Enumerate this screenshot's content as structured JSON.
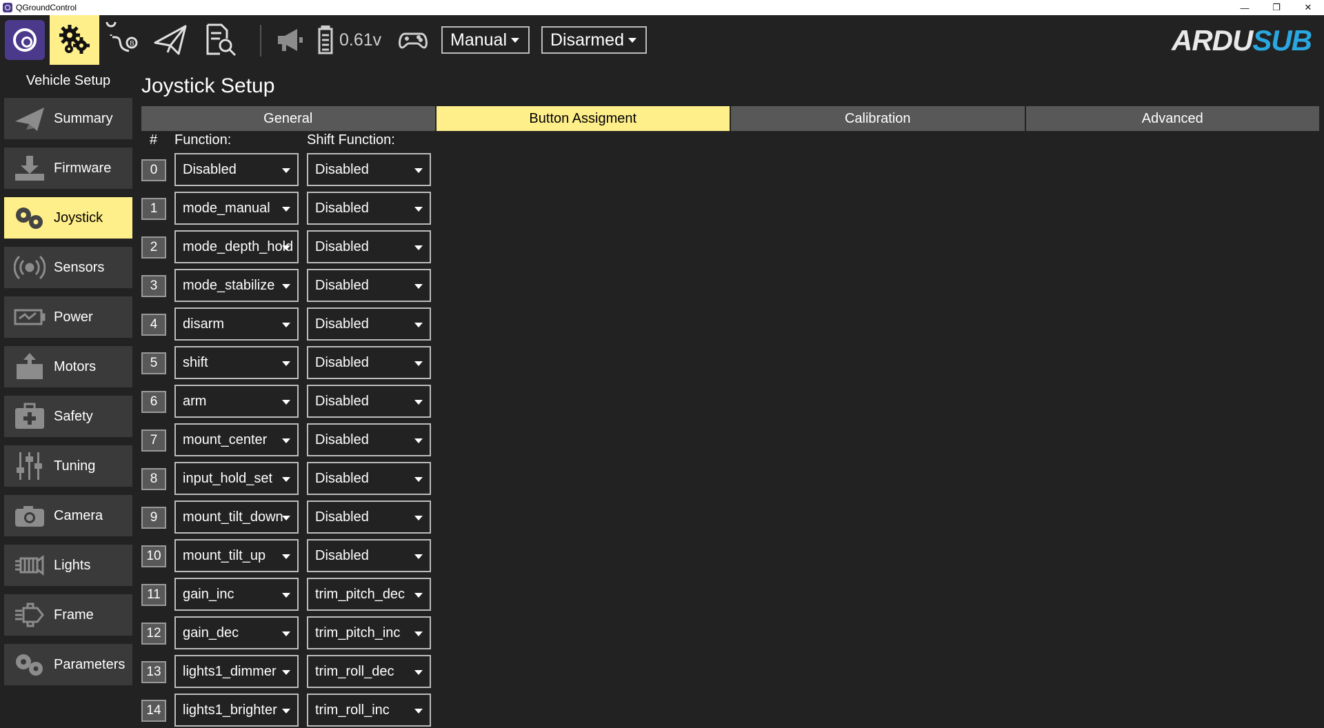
{
  "window": {
    "title": "QGroundControl"
  },
  "toolbar": {
    "battery_voltage": "0.61v",
    "flight_mode": "Manual",
    "arm_state": "Disarmed"
  },
  "logo": {
    "text_part1": "ARDU",
    "text_part2": "SUB",
    "color_part2": "#2aa7e0"
  },
  "sidebar": {
    "title": "Vehicle Setup",
    "items": [
      {
        "label": "Summary",
        "icon": "paper-plane-icon"
      },
      {
        "label": "Firmware",
        "icon": "download-icon"
      },
      {
        "label": "Joystick",
        "icon": "gears-icon",
        "active": true
      },
      {
        "label": "Sensors",
        "icon": "radio-waves-icon"
      },
      {
        "label": "Power",
        "icon": "battery-wave-icon"
      },
      {
        "label": "Motors",
        "icon": "motor-icon"
      },
      {
        "label": "Safety",
        "icon": "first-aid-icon"
      },
      {
        "label": "Tuning",
        "icon": "sliders-icon"
      },
      {
        "label": "Camera",
        "icon": "camera-icon"
      },
      {
        "label": "Lights",
        "icon": "light-icon"
      },
      {
        "label": "Frame",
        "icon": "frame-icon"
      },
      {
        "label": "Parameters",
        "icon": "gears-icon"
      }
    ]
  },
  "page": {
    "title": "Joystick Setup",
    "tabs": [
      {
        "label": "General"
      },
      {
        "label": "Button Assigment",
        "active": true
      },
      {
        "label": "Calibration"
      },
      {
        "label": "Advanced"
      }
    ],
    "headers": {
      "num": "#",
      "function": "Function:",
      "shift": "Shift Function:"
    },
    "rows": [
      {
        "num": "0",
        "function": "Disabled",
        "shift": "Disabled"
      },
      {
        "num": "1",
        "function": "mode_manual",
        "shift": "Disabled"
      },
      {
        "num": "2",
        "function": "mode_depth_hold",
        "shift": "Disabled"
      },
      {
        "num": "3",
        "function": "mode_stabilize",
        "shift": "Disabled"
      },
      {
        "num": "4",
        "function": "disarm",
        "shift": "Disabled"
      },
      {
        "num": "5",
        "function": "shift",
        "shift": "Disabled"
      },
      {
        "num": "6",
        "function": "arm",
        "shift": "Disabled"
      },
      {
        "num": "7",
        "function": "mount_center",
        "shift": "Disabled"
      },
      {
        "num": "8",
        "function": "input_hold_set",
        "shift": "Disabled"
      },
      {
        "num": "9",
        "function": "mount_tilt_down",
        "shift": "Disabled"
      },
      {
        "num": "10",
        "function": "mount_tilt_up",
        "shift": "Disabled"
      },
      {
        "num": "11",
        "function": "gain_inc",
        "shift": "trim_pitch_dec"
      },
      {
        "num": "12",
        "function": "gain_dec",
        "shift": "trim_pitch_inc"
      },
      {
        "num": "13",
        "function": "lights1_dimmer",
        "shift": "trim_roll_dec"
      },
      {
        "num": "14",
        "function": "lights1_brighter",
        "shift": "trim_roll_inc"
      }
    ]
  },
  "colors": {
    "accent": "#ffef8a",
    "background": "#222222",
    "button": "#3a3a3a",
    "tab": "#585858",
    "qgc_brand": "#4b3a8c"
  }
}
